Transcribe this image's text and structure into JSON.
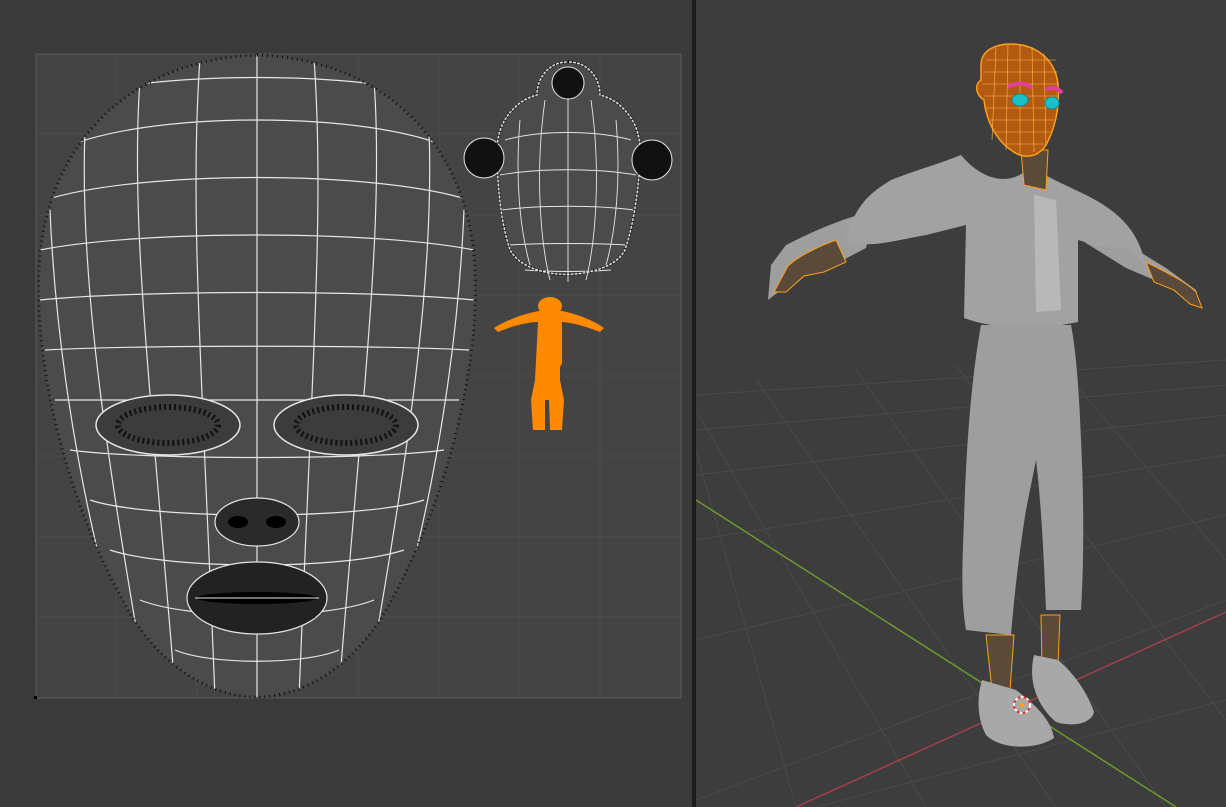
{
  "uv_editor": {
    "background": "#3a3a3a",
    "grid_color": "#474747",
    "wire_color": "#e6e6e6",
    "vertex_color": "#000000",
    "selected_color": "#ff8a00"
  },
  "viewport": {
    "background": "#3d3d3d",
    "floor_grid_color": "#4a4a4a",
    "x_axis_color": "#a3404a",
    "y_axis_color": "#6c9a2e",
    "model_color": "#9e9e9e",
    "selection_wire_color": "#ff9f1a",
    "eyebrow_color": "#e0409a",
    "eye_color": "#19c0c8"
  }
}
